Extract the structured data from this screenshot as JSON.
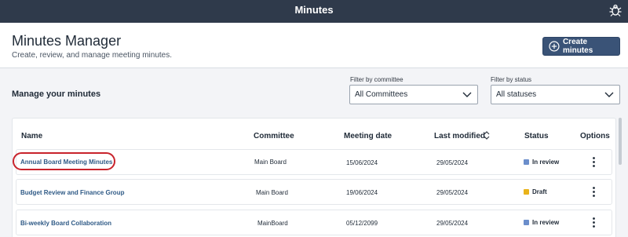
{
  "topbar": {
    "title": "Minutes",
    "bug_icon": "bug-icon"
  },
  "header": {
    "title": "Minutes Manager",
    "subtitle": "Create, review, and manage meeting minutes.",
    "create_button": {
      "label": "Create minutes",
      "icon": "plus-circle-icon"
    }
  },
  "filters": {
    "section_title": "Manage your minutes",
    "committee": {
      "label": "Filter by committee",
      "value": "All Committees"
    },
    "status": {
      "label": "Filter by status",
      "value": "All statuses"
    }
  },
  "table": {
    "columns": [
      "Name",
      "Committee",
      "Meeting date",
      "Last modified",
      "Status",
      "Options"
    ],
    "sort_icon": "sort-icon",
    "rows": [
      {
        "name": "Annual Board Meeting Minutes",
        "committee": "Main Board",
        "meeting_date": "15/06/2024",
        "last_modified": "29/05/2024",
        "status": "In review",
        "status_color": "#6b8ecb"
      },
      {
        "name": "Budget Review and Finance Group",
        "committee": "Main Board",
        "meeting_date": "19/06/2024",
        "last_modified": "29/05/2024",
        "status": "Draft",
        "status_color": "#e9b31a"
      },
      {
        "name": "Bi-weekly Board Collaboration",
        "committee": "MainBoard",
        "meeting_date": "05/12/2099",
        "last_modified": "29/05/2024",
        "status": "In review",
        "status_color": "#6b8ecb"
      }
    ]
  },
  "colors": {
    "topbar": "#2f3a4b",
    "primary_button": "#3a5377",
    "link": "#2f5a86",
    "highlight": "#c8232c"
  }
}
